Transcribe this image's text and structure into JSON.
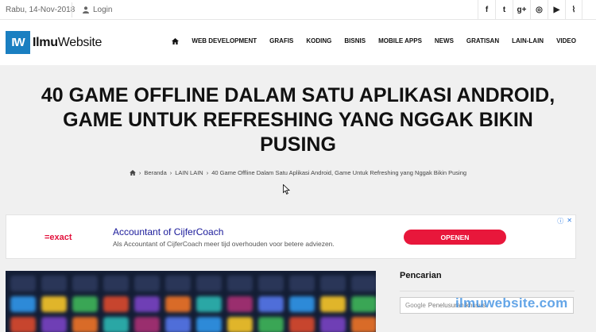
{
  "topbar": {
    "date": "Rabu, 14-Nov-2018",
    "login": "Login",
    "social": [
      {
        "icon": "facebook-icon",
        "glyph": "f"
      },
      {
        "icon": "twitter-icon",
        "glyph": "t"
      },
      {
        "icon": "google-plus-icon",
        "glyph": "g+"
      },
      {
        "icon": "instagram-icon",
        "glyph": "◎"
      },
      {
        "icon": "youtube-icon",
        "glyph": "▶"
      },
      {
        "icon": "rss-icon",
        "glyph": "⌇"
      }
    ]
  },
  "header": {
    "logo_mark": "IW",
    "logo_part1": "Ilmu",
    "logo_part2": "Website",
    "nav": [
      "WEB DEVELOPMENT",
      "GRAFIS",
      "KODING",
      "BISNIS",
      "MOBILE APPS",
      "NEWS",
      "GRATISAN",
      "LAIN-LAIN",
      "VIDEO"
    ]
  },
  "hero": {
    "title_lines": [
      "40 GAME OFFLINE DALAM SATU APLIKASI ANDROID,",
      "GAME UNTUK REFRESHING YANG NGGAK BIKIN",
      "PUSING"
    ],
    "breadcrumb": {
      "home": "Beranda",
      "category": "LAIN LAIN",
      "current": "40 Game Offline Dalam Satu Aplikasi Android, Game Untuk Refreshing yang Nggak Bikin Pusing"
    }
  },
  "ad": {
    "brand": "=exact",
    "title": "Accountant of CijferCoach",
    "description": "Als Accountant of CijferCoach meer tijd overhouden voor betere adviezen.",
    "cta": "OPENEN",
    "info_icon": "ⓘ",
    "close_icon": "✕"
  },
  "sidebar": {
    "heading": "Pencarian",
    "search_google": "Google",
    "search_placeholder": "Penelusuran khusus"
  },
  "watermark": "ilmuwebsite.com",
  "colors": {
    "accent": "#1a7fc1",
    "cta": "#e8173b",
    "ad_brand": "#e3123d"
  }
}
